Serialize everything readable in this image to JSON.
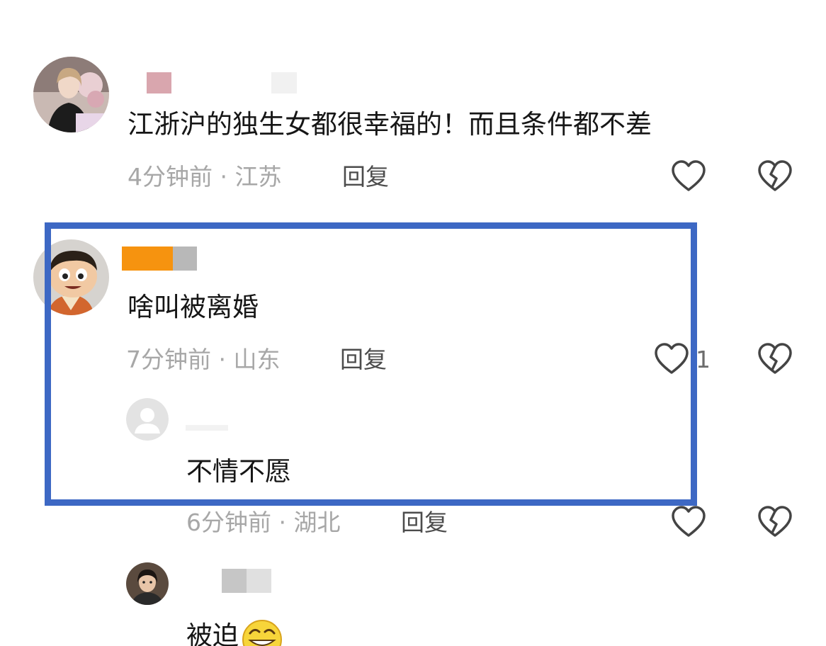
{
  "comments": [
    {
      "text": "江浙沪的独生女都很幸福的！而且条件都不差",
      "time": "4分钟前",
      "location": "江苏",
      "reply_label": "回复",
      "like_count": ""
    },
    {
      "text": "啥叫被离婚",
      "time": "7分钟前",
      "location": "山东",
      "reply_label": "回复",
      "like_count": "1",
      "replies": [
        {
          "text": "不情不愿",
          "time": "6分钟前",
          "location": "湖北",
          "reply_label": "回复",
          "like_count": ""
        },
        {
          "text": "被迫",
          "emoji": "grinning-emoji"
        }
      ]
    }
  ],
  "separator": " · ",
  "colors": {
    "highlight_border": "#3d68c4",
    "meta_text": "#a7a7a7",
    "reply_text": "#4c4c4c",
    "icon_stroke": "#444444",
    "username_orange": "#f6930f"
  },
  "icons": [
    "heart-icon",
    "broken-heart-icon",
    "default-avatar-icon"
  ]
}
